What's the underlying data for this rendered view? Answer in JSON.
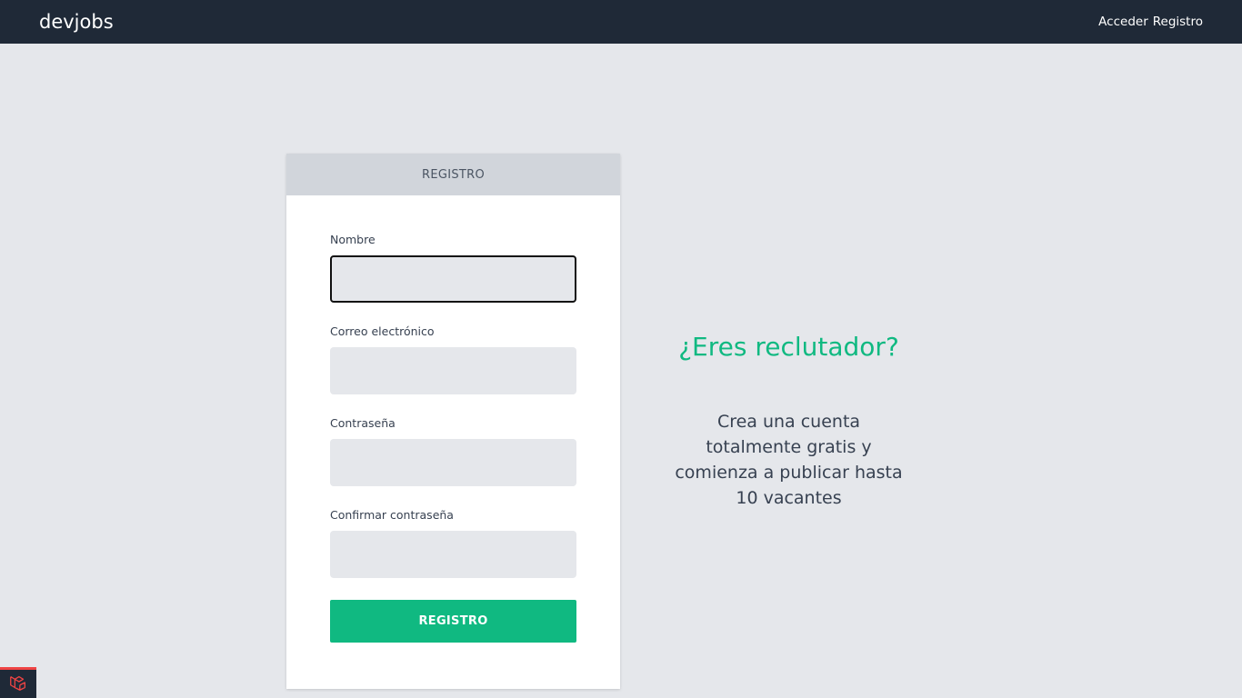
{
  "navbar": {
    "brand": "devjobs",
    "links": [
      {
        "label": "Acceder"
      },
      {
        "label": "Registro"
      }
    ]
  },
  "card": {
    "header": "REGISTRO",
    "fields": [
      {
        "label": "Nombre",
        "value": "",
        "placeholder": "",
        "focused": true
      },
      {
        "label": "Correo electrónico",
        "value": "",
        "placeholder": ""
      },
      {
        "label": "Contraseña",
        "value": "",
        "placeholder": ""
      },
      {
        "label": "Confirmar contraseña",
        "value": "",
        "placeholder": ""
      }
    ],
    "submit_label": "REGISTRO"
  },
  "promo": {
    "title": "¿Eres reclutador?",
    "text": "Crea una cuenta totalmente gratis y comienza a publicar hasta 10 vacantes"
  },
  "colors": {
    "navbar_bg": "#1f2937",
    "accent": "#10b981",
    "page_bg": "#e5e7eb"
  },
  "icons": {
    "debug_badge": "laravel-icon"
  }
}
